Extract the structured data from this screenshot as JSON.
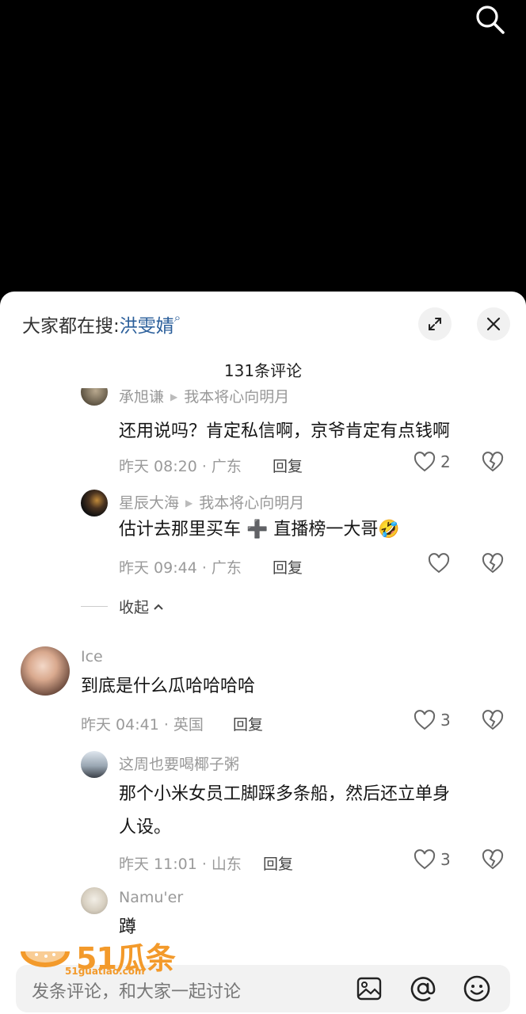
{
  "hot_search": {
    "prefix": "大家都在搜:",
    "keyword": "洪雯婧",
    "search_glyph": "⌕"
  },
  "header": {
    "count": "131条评论"
  },
  "comments": [
    {
      "user": "承旭谦",
      "reply_to": "我本将心向明月",
      "text": "还用说吗？肯定私信啊，京爷肯定有点钱啊",
      "meta": "昨天 08:20 · 广东",
      "reply": "回复",
      "likes": "2"
    },
    {
      "user": "星辰大海",
      "reply_to": "我本将心向明月",
      "text": "估计去那里买车 ➕ 直播榜一大哥🤣",
      "meta": "昨天 09:44 · 广东",
      "reply": "回复",
      "likes": ""
    },
    {
      "user": "Ice",
      "text": "到底是什么瓜哈哈哈哈",
      "meta": "昨天 04:41 · 英国",
      "reply": "回复",
      "likes": "3"
    },
    {
      "user": "这周也要喝椰子粥",
      "text_line1": "那个小米女员工脚踩多条船，然后还立单身",
      "text_line2": "人设。",
      "meta": "昨天 11:01 · 山东",
      "reply": "回复",
      "likes": "3"
    },
    {
      "user": "Namu'er",
      "text": "蹲"
    }
  ],
  "collapse": {
    "label": "收起"
  },
  "input": {
    "placeholder": "发条评论，和大家一起讨论"
  },
  "watermark": {
    "brand": "51瓜条",
    "url": "51guatiao.com"
  },
  "icons": [
    "search-icon",
    "expand-icon",
    "close-icon",
    "heart-icon",
    "broken-heart-icon",
    "image-icon",
    "at-icon",
    "emoji-icon"
  ],
  "colors": {
    "keyword": "#2a5e9a",
    "accent_watermark": "#f39a2b"
  }
}
